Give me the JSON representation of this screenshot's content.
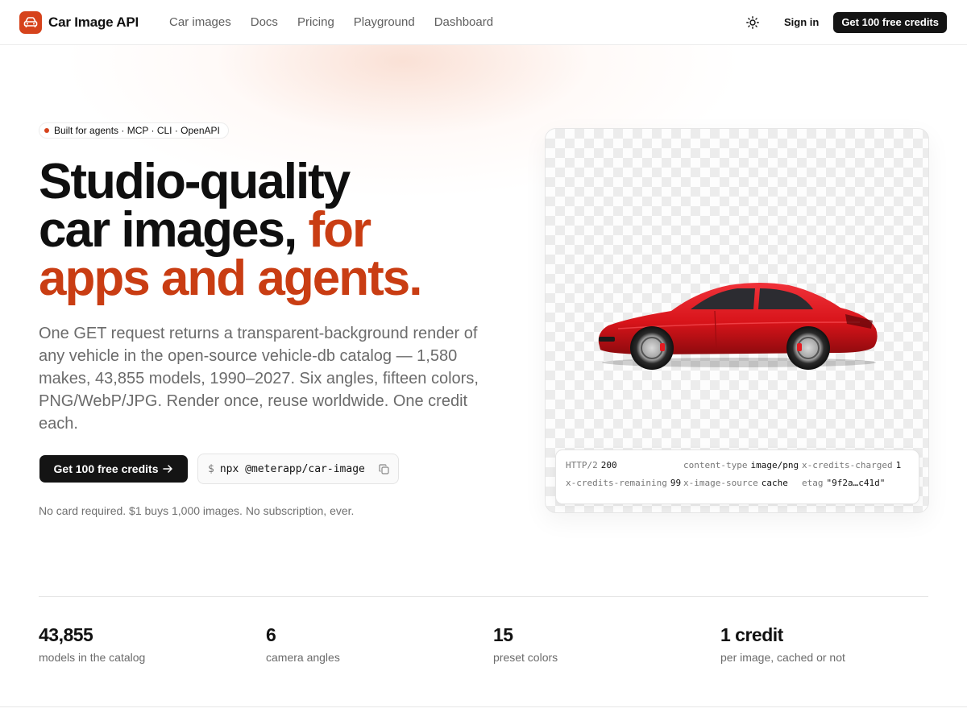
{
  "nav": {
    "brand": "Car Image API",
    "links": [
      "Car images",
      "Docs",
      "Pricing",
      "Playground",
      "Dashboard"
    ],
    "signin": "Sign in",
    "cta": "Get 100 free credits"
  },
  "hero": {
    "badge": "Built for agents · MCP · CLI · OpenAPI",
    "headline_line1": "Studio-quality",
    "headline_line2a": "car images, ",
    "headline_line2b": "for",
    "headline_line3": "apps and agents.",
    "subtext": "One GET request returns a transparent-background render of any vehicle in the open-source vehicle-db catalog — 1,580 makes, 43,855 models, 1990–2027. Six angles, fifteen colors, PNG/WebP/JPG. Render once, reuse worldwide. One credit each.",
    "cta": "Get 100 free credits",
    "command_prompt": "$",
    "command": "npx @meterapp/car-image",
    "note": "No card required. $1 buys 1,000 images. No subscription, ever."
  },
  "response_headers": [
    {
      "key": "HTTP/2",
      "value": "200"
    },
    {
      "key": "content-type",
      "value": "image/png"
    },
    {
      "key": "x-credits-charged",
      "value": "1"
    },
    {
      "key": "x-credits-remaining",
      "value": "99"
    },
    {
      "key": "x-image-source",
      "value": "cache"
    },
    {
      "key": "etag",
      "value": "\"9f2a…c41d\""
    }
  ],
  "stats": [
    {
      "value": "43,855",
      "label": "models in the catalog"
    },
    {
      "value": "6",
      "label": "camera angles"
    },
    {
      "value": "15",
      "label": "preset colors"
    },
    {
      "value": "1 credit",
      "label": "per image, cached or not"
    }
  ],
  "colors": {
    "accent": "#c93d13",
    "brand": "#d6431c",
    "dark_button": "#141414",
    "car_body": "#d8141a"
  },
  "icons": {
    "logo": "car-icon",
    "theme": "sun-icon",
    "arrow": "arrow-right-icon",
    "copy": "copy-icon"
  }
}
